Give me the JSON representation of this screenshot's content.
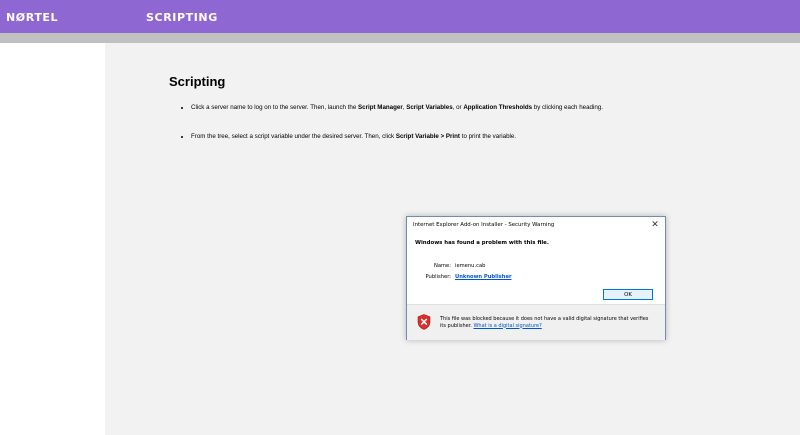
{
  "header": {
    "logo": "NØRTEL",
    "section_title": "SCRIPTING"
  },
  "main": {
    "heading": "Scripting",
    "bullets": [
      {
        "parts": [
          {
            "text": "Click a server name to log on to the server.  Then, launch the ",
            "bold": false
          },
          {
            "text": "Script Manager",
            "bold": true
          },
          {
            "text": ", ",
            "bold": false
          },
          {
            "text": "Script Variables",
            "bold": true
          },
          {
            "text": ", or ",
            "bold": false
          },
          {
            "text": "Application Thresholds",
            "bold": true
          },
          {
            "text": " by clicking each heading.",
            "bold": false
          }
        ]
      },
      {
        "parts": [
          {
            "text": "From the tree, select a script variable under the desired server.  Then, click ",
            "bold": false
          },
          {
            "text": "Script Variable > Print",
            "bold": true
          },
          {
            "text": " to print the variable.",
            "bold": false
          }
        ]
      }
    ]
  },
  "dialog": {
    "title": "Internet Explorer Add-on Installer - Security Warning",
    "close_glyph": "✕",
    "heading": "Windows has found a problem with this file.",
    "name_label": "Name:",
    "name_value": "iemenu.cab",
    "publisher_label": "Publisher:",
    "publisher_value": "Unknown Publisher",
    "ok_label": "OK",
    "footer_text": "This file was blocked because it does not have a valid digital signature that verifies its publisher.",
    "footer_link": "What is a digital signature?",
    "icon": "security-shield-x-icon"
  },
  "colors": {
    "header_bg": "#8f67d3",
    "content_bg": "#f2f2f2",
    "link": "#0055cc",
    "shield_red": "#d9302b"
  }
}
